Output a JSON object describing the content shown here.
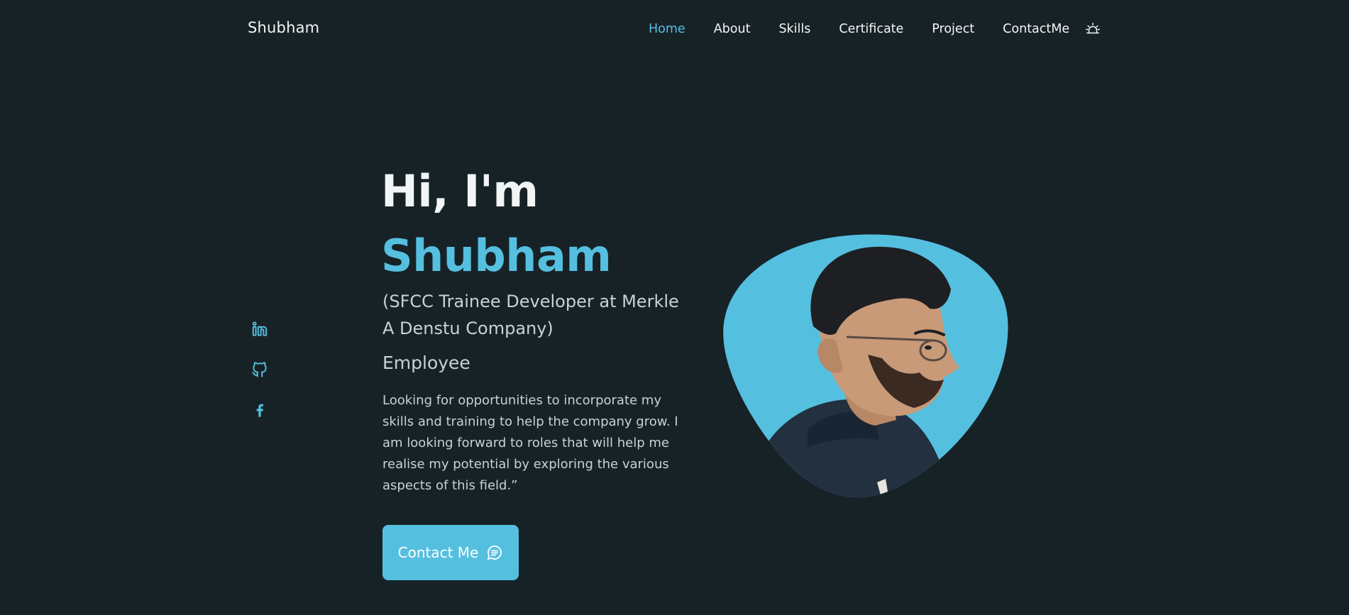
{
  "header": {
    "logo": "Shubham",
    "nav": [
      {
        "label": "Home",
        "active": true
      },
      {
        "label": "About",
        "active": false
      },
      {
        "label": "Skills",
        "active": false
      },
      {
        "label": "Certificate",
        "active": false
      },
      {
        "label": "Project",
        "active": false
      },
      {
        "label": "ContactMe",
        "active": false
      }
    ],
    "theme_icon": "sun-icon"
  },
  "social": [
    {
      "icon": "linkedin-icon"
    },
    {
      "icon": "github-icon"
    },
    {
      "icon": "facebook-icon"
    }
  ],
  "hero": {
    "greeting": "Hi, I'm",
    "name": "Shubham",
    "role": "(SFCC Trainee Developer at Merkle A Denstu Company)",
    "status": "Employee",
    "description": "Looking for opportunities to incorporate my skills and training to help the company grow. I am looking forward to roles that will help me realise my potential by exploring the various aspects of this field.”",
    "cta_label": "Contact Me",
    "cta_icon": "chat-icon"
  },
  "profile_image": "profile-photo",
  "colors": {
    "background": "#172226",
    "accent": "#55bfe0",
    "text": "#f2f5f6",
    "muted": "#c9d1d4"
  }
}
